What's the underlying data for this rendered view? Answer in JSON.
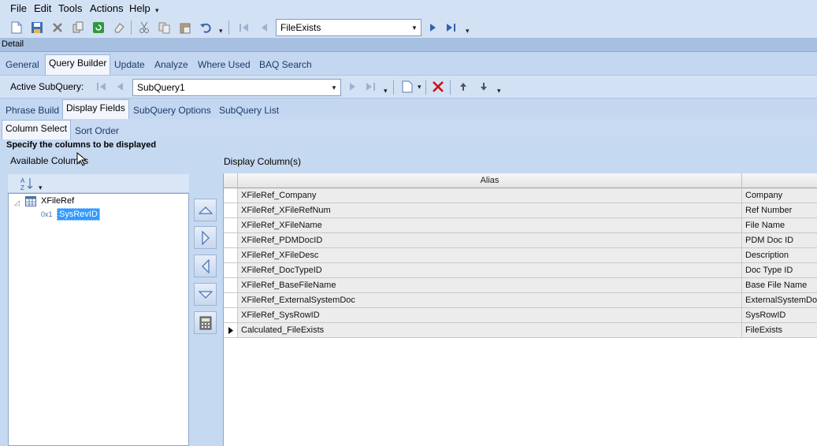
{
  "menu": [
    "File",
    "Edit",
    "Tools",
    "Actions",
    "Help"
  ],
  "toolbar": {
    "query_combo_value": "FileExists",
    "icons": [
      "new-icon",
      "save-icon",
      "delete-icon",
      "copy-icon",
      "refresh-icon",
      "clear-icon",
      "cut-icon",
      "copy-clip-icon",
      "paste-icon",
      "undo-icon",
      "first-icon",
      "prev-icon",
      "next-icon",
      "last-icon"
    ]
  },
  "detail_label": "Detail",
  "main_tabs": [
    "General",
    "Query Builder",
    "Update",
    "Analyze",
    "Where Used",
    "BAQ Search"
  ],
  "subquery": {
    "label": "Active SubQuery:",
    "value": "SubQuery1"
  },
  "sub_tabs": [
    "Phrase Build",
    "Display Fields",
    "SubQuery Options",
    "SubQuery List"
  ],
  "inner_tabs": [
    "Column Select",
    "Sort Order"
  ],
  "instruction": "Specify the columns to be displayed",
  "available_title": "Available Columns",
  "display_title": "Display Column(s)",
  "tree": {
    "root": "XFileRef",
    "child_prefix": "0x1",
    "child": "SysRevID"
  },
  "grid": {
    "columns": [
      "Alias",
      ""
    ],
    "rows": [
      {
        "alias": "XFileRef_Company",
        "label": "Company"
      },
      {
        "alias": "XFileRef_XFileRefNum",
        "label": "Ref Number"
      },
      {
        "alias": "XFileRef_XFileName",
        "label": "File Name"
      },
      {
        "alias": "XFileRef_PDMDocID",
        "label": "PDM Doc ID"
      },
      {
        "alias": "XFileRef_XFileDesc",
        "label": "Description"
      },
      {
        "alias": "XFileRef_DocTypeID",
        "label": "Doc Type ID"
      },
      {
        "alias": "XFileRef_BaseFileName",
        "label": "Base File Name"
      },
      {
        "alias": "XFileRef_ExternalSystemDoc",
        "label": "ExternalSystemDoc"
      },
      {
        "alias": "XFileRef_SysRowID",
        "label": "SysRowID"
      },
      {
        "alias": "Calculated_FileExists",
        "label": "FileExists"
      }
    ]
  },
  "colors": {
    "accent": "#1f5fbf",
    "selection": "#3399ff",
    "delete_red": "#d01010"
  }
}
